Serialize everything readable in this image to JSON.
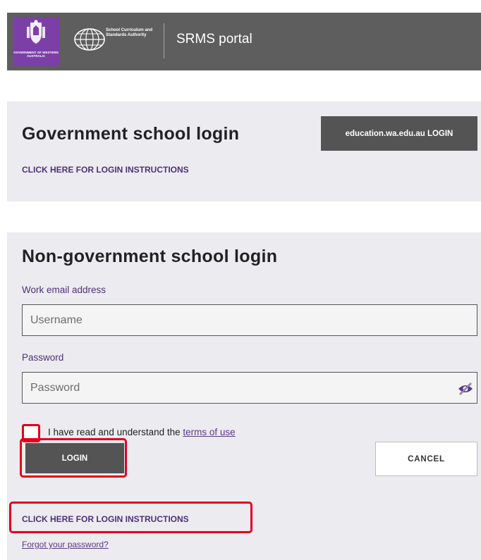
{
  "header": {
    "gov_logo_text": "GOVERNMENT OF WESTERN AUSTRALIA",
    "scsa_name": "School Curriculum and Standards Authority",
    "portal_title": "SRMS portal",
    "brand_purple": "#7c3fa8",
    "bar_color": "#5e5e5e"
  },
  "government": {
    "heading": "Government school login",
    "edu_login_label": "education.wa.edu.au LOGIN",
    "instructions_link": "CLICK HERE FOR LOGIN INSTRUCTIONS"
  },
  "non_government": {
    "heading": "Non-government school login",
    "email_label": "Work email address",
    "username_placeholder": "Username",
    "password_label": "Password",
    "password_placeholder": "Password",
    "terms_prefix": "I have read and understand the ",
    "terms_link": "terms of use",
    "login_label": "LOGIN",
    "cancel_label": "CANCEL",
    "instructions_link": "CLICK HERE FOR LOGIN INSTRUCTIONS",
    "forgot_link": "Forgot your password?",
    "highlight_color": "#e3001b",
    "link_color": "#4e3176"
  },
  "icons": {
    "crest": "wa-crest-icon",
    "scsa": "scsa-emblem-icon",
    "eye": "show-password-eye-icon"
  }
}
